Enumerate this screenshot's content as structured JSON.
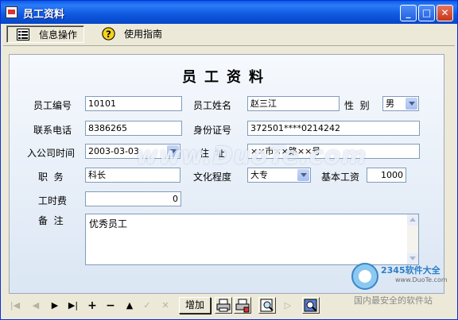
{
  "window": {
    "title": "员工资料",
    "minimize": "_",
    "maximize": "□",
    "close": "✕"
  },
  "menu": {
    "info_ops": "信息操作",
    "guide": "使用指南"
  },
  "form": {
    "heading": "员工资料",
    "labels": {
      "emp_no": "员工编号",
      "emp_name": "员工姓名",
      "gender": "性  别",
      "phone": "联系电话",
      "id_no": "身份证号",
      "join_date": "入公司时间",
      "address": "住  址",
      "position": "职  务",
      "education": "文化程度",
      "base_salary": "基本工资",
      "hourly_fee": "工时费",
      "remarks": "备  注"
    },
    "values": {
      "emp_no": "10101",
      "emp_name": "赵三江",
      "gender": "男",
      "phone": "8386265",
      "id_no": "372501****0214242",
      "join_date": "2003-03-03",
      "address": "××市××路××号",
      "position": "科长",
      "education": "大专",
      "base_salary": "1000",
      "hourly_fee": "0",
      "remarks": "优秀员工"
    }
  },
  "toolbar": {
    "add_label": "增加"
  },
  "watermark": {
    "site": "www.DuoTe.com",
    "brand": "2345软件大全",
    "brand_url": "www.DuoTe.com",
    "slogan": "国内最安全的软件站"
  }
}
